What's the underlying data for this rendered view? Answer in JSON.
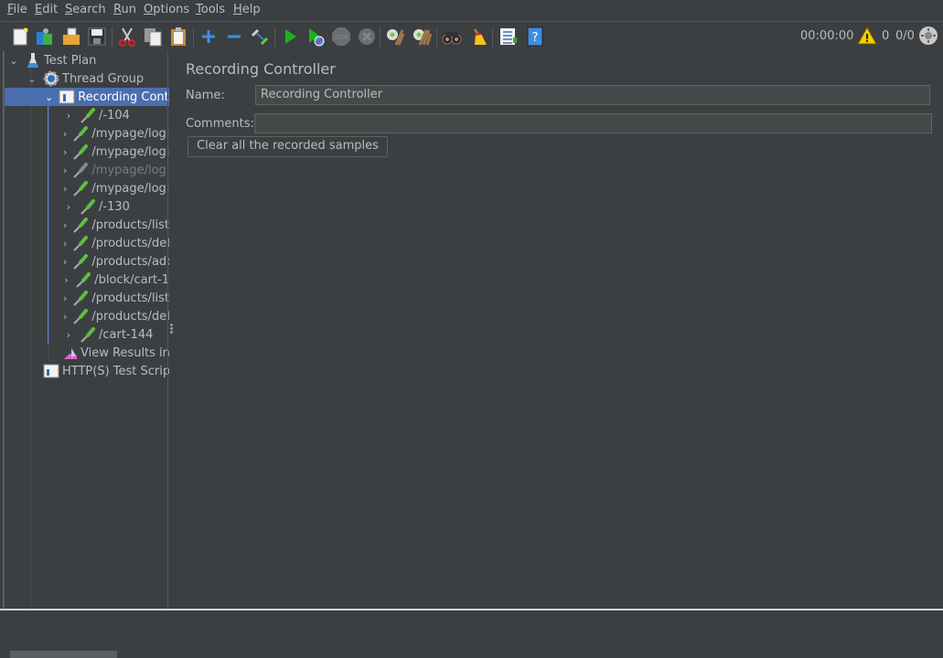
{
  "menu": [
    {
      "label": "File",
      "mnemonic": "F",
      "rest": "ile"
    },
    {
      "label": "Edit",
      "mnemonic": "E",
      "rest": "dit"
    },
    {
      "label": "Search",
      "mnemonic": "S",
      "rest": "earch"
    },
    {
      "label": "Run",
      "mnemonic": "R",
      "rest": "un"
    },
    {
      "label": "Options",
      "mnemonic": "O",
      "rest": "ptions"
    },
    {
      "label": "Tools",
      "mnemonic": "T",
      "rest": "ools"
    },
    {
      "label": "Help",
      "mnemonic": "H",
      "rest": "elp"
    }
  ],
  "toolbar": {
    "buttons": [
      "new-icon",
      "templates-icon",
      "open-icon",
      "save-icon",
      "cut-icon",
      "copy-icon",
      "paste-icon",
      "expand-icon",
      "collapse-icon",
      "toggle-icon",
      "start-icon",
      "start-no-pause-icon",
      "stop-icon",
      "shutdown-icon",
      "clear-icon",
      "clear-all-icon",
      "search-icon",
      "reset-search-icon",
      "function-helper-icon",
      "help-icon"
    ],
    "timer": "00:00:00",
    "warning_count": "0",
    "threads": "0/0"
  },
  "tree": {
    "items": [
      {
        "label": "Test Plan",
        "icon": "flask-icon"
      },
      {
        "label": "Thread Group",
        "icon": "gear-icon"
      },
      {
        "label": "Recording Controller",
        "icon": "controller-icon",
        "selected": true
      },
      {
        "label": "/-104",
        "icon": "sampler-icon"
      },
      {
        "label": "/mypage/login",
        "icon": "sampler-icon"
      },
      {
        "label": "/mypage/login",
        "icon": "sampler-icon"
      },
      {
        "label": "/mypage/login",
        "icon": "sampler-icon",
        "disabled": true
      },
      {
        "label": "/mypage/login",
        "icon": "sampler-icon"
      },
      {
        "label": "/-130",
        "icon": "sampler-icon"
      },
      {
        "label": "/products/list",
        "icon": "sampler-icon"
      },
      {
        "label": "/products/detail",
        "icon": "sampler-icon"
      },
      {
        "label": "/products/add",
        "icon": "sampler-icon"
      },
      {
        "label": "/block/cart-1",
        "icon": "sampler-icon"
      },
      {
        "label": "/products/list",
        "icon": "sampler-icon"
      },
      {
        "label": "/products/detail",
        "icon": "sampler-icon"
      },
      {
        "label": "/cart-144",
        "icon": "sampler-icon"
      },
      {
        "label": "View Results in Tree",
        "icon": "listener-icon"
      },
      {
        "label": "HTTP(S) Test Script Recorder",
        "icon": "recorder-icon"
      }
    ]
  },
  "panel": {
    "title": "Recording Controller",
    "name_label": "Name:",
    "name_value": "Recording Controller",
    "comments_label": "Comments:",
    "comments_value": "",
    "clear_button": "Clear all the recorded samples"
  }
}
